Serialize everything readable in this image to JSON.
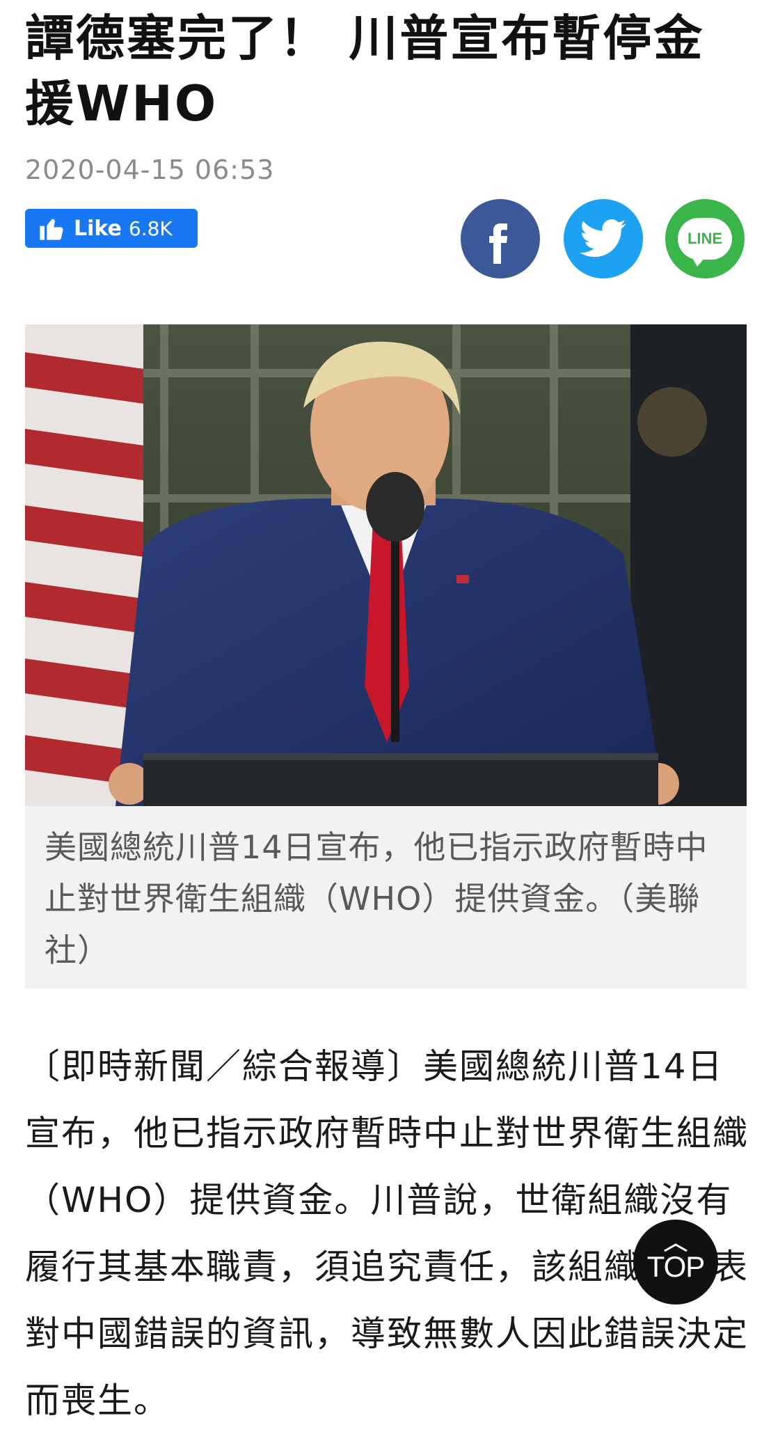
{
  "article": {
    "title": "譚德塞完了！ 川普宣布暫停金援WHO",
    "timestamp": "2020-04-15 06:53",
    "caption": "美國總統川普14日宣布，他已指示政府暫時中止對世界衛生組織（WHO）提供資金。（美聯社）",
    "body": "〔即時新聞／綜合報導〕美國總統川普14日宣布，他已指示政府暫時中止對世界衛生組織（WHO）提供資金。川普說，世衛組織沒有履行其基本職責，須追究責任，該組織還發表對中國錯誤的資訊，導致無數人因此錯誤決定而喪生。"
  },
  "social": {
    "like_label": "Like",
    "like_count": "6.8K",
    "line_label": "LINE"
  },
  "controls": {
    "top_label": "TOP"
  },
  "colors": {
    "facebook": "#3b5998",
    "twitter": "#1da1f2",
    "line": "#39b54a",
    "like_button": "#1877f2",
    "top_button": "#111111"
  },
  "icons": [
    "thumbs-up-icon",
    "facebook-icon",
    "twitter-icon",
    "line-icon",
    "chevron-up-icon"
  ]
}
